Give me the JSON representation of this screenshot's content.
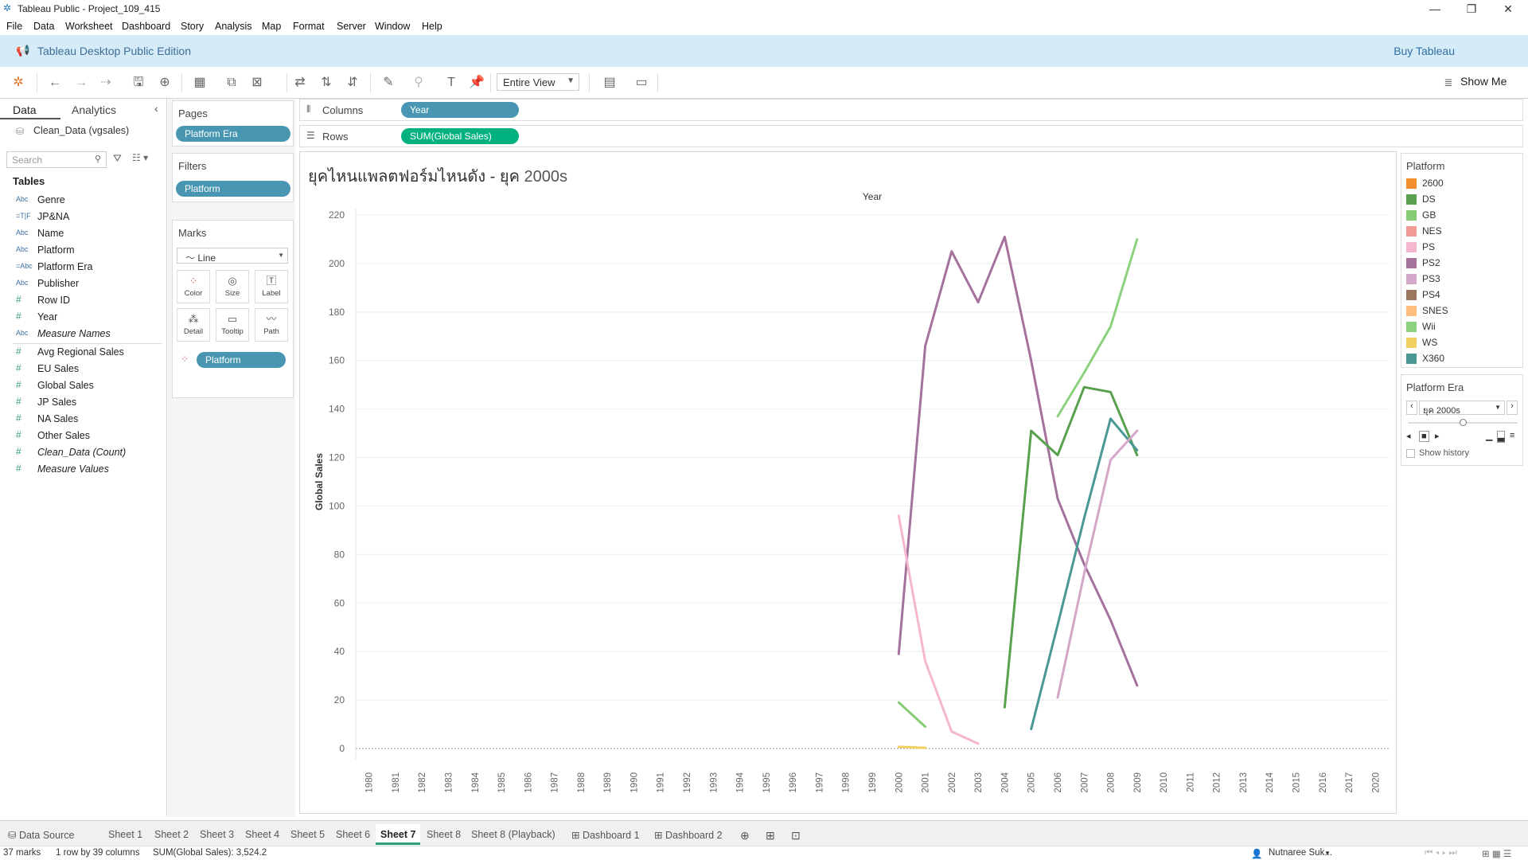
{
  "window": {
    "title": "Tableau Public - Project_109_415"
  },
  "menu": [
    "File",
    "Data",
    "Worksheet",
    "Dashboard",
    "Story",
    "Analysis",
    "Map",
    "Format",
    "Server",
    "Window",
    "Help"
  ],
  "banner": {
    "edition": "Tableau Desktop Public Edition",
    "buy": "Buy Tableau"
  },
  "toolbar": {
    "fit": "Entire View",
    "show_me": "Show Me"
  },
  "data_pane": {
    "tabs": [
      "Data",
      "Analytics"
    ],
    "datasource": "Clean_Data (vgsales)",
    "search_placeholder": "Search",
    "tables_label": "Tables",
    "dimensions": [
      {
        "icon": "Abc",
        "name": "Genre"
      },
      {
        "icon": "=T|F",
        "name": "JP&NA"
      },
      {
        "icon": "Abc",
        "name": "Name"
      },
      {
        "icon": "Abc",
        "name": "Platform"
      },
      {
        "icon": "=Abc",
        "name": "Platform Era"
      },
      {
        "icon": "Abc",
        "name": "Publisher"
      },
      {
        "icon": "#",
        "name": "Row ID"
      },
      {
        "icon": "#",
        "name": "Year"
      },
      {
        "icon": "Abc",
        "name": "Measure Names"
      }
    ],
    "measures": [
      {
        "icon": "#",
        "name": "Avg Regional Sales"
      },
      {
        "icon": "#",
        "name": "EU Sales"
      },
      {
        "icon": "#",
        "name": "Global Sales"
      },
      {
        "icon": "#",
        "name": "JP Sales"
      },
      {
        "icon": "#",
        "name": "NA Sales"
      },
      {
        "icon": "#",
        "name": "Other Sales"
      },
      {
        "icon": "#",
        "name": "Clean_Data (Count)"
      },
      {
        "icon": "#",
        "name": "Measure Values"
      }
    ]
  },
  "cards": {
    "pages": {
      "title": "Pages",
      "pill": "Platform Era"
    },
    "filters": {
      "title": "Filters",
      "pill": "Platform"
    },
    "marks": {
      "title": "Marks",
      "type": "Line",
      "buttons": [
        "Color",
        "Size",
        "Label",
        "Detail",
        "Tooltip",
        "Path"
      ],
      "color_pill": "Platform"
    }
  },
  "shelves": {
    "columns": {
      "label": "Columns",
      "pill": "Year"
    },
    "rows": {
      "label": "Rows",
      "pill": "SUM(Global Sales)"
    }
  },
  "sheet": {
    "title": "ยุคไหนแพลตฟอร์มไหนดัง - ยุค",
    "title_sub": "2000s"
  },
  "chart_data": {
    "type": "line",
    "xlabel": "Year",
    "ylabel": "Global Sales",
    "ylim": [
      0,
      220
    ],
    "yticks": [
      0,
      20,
      40,
      60,
      80,
      100,
      120,
      140,
      160,
      180,
      200,
      220
    ],
    "x": [
      1980,
      1981,
      1982,
      1983,
      1984,
      1985,
      1986,
      1987,
      1988,
      1989,
      1990,
      1991,
      1992,
      1993,
      1994,
      1995,
      1996,
      1997,
      1998,
      1999,
      2000,
      2001,
      2002,
      2003,
      2004,
      2005,
      2006,
      2007,
      2008,
      2009,
      2010,
      2011,
      2012,
      2013,
      2014,
      2015,
      2016,
      2017,
      2020
    ],
    "series": [
      {
        "name": "PS2",
        "color": "#a4729c",
        "points": [
          [
            2000,
            39
          ],
          [
            2001,
            166
          ],
          [
            2002,
            205
          ],
          [
            2003,
            184
          ],
          [
            2004,
            211
          ],
          [
            2005,
            160
          ],
          [
            2006,
            103
          ],
          [
            2007,
            76
          ],
          [
            2008,
            53
          ],
          [
            2009,
            26
          ]
        ]
      },
      {
        "name": "PS",
        "color": "#f4b7cf",
        "points": [
          [
            2000,
            96
          ],
          [
            2001,
            36
          ],
          [
            2002,
            7
          ],
          [
            2003,
            2
          ]
        ]
      },
      {
        "name": "GB",
        "color": "#86cc74",
        "points": [
          [
            2000,
            19
          ],
          [
            2001,
            9
          ]
        ]
      },
      {
        "name": "WS",
        "color": "#f2cf61",
        "points": [
          [
            2000,
            0.7
          ],
          [
            2001,
            0.3
          ]
        ]
      },
      {
        "name": "DS",
        "color": "#59a14f",
        "points": [
          [
            2004,
            17
          ],
          [
            2005,
            131
          ],
          [
            2006,
            121
          ],
          [
            2007,
            149
          ],
          [
            2008,
            147
          ],
          [
            2009,
            121
          ]
        ]
      },
      {
        "name": "Wii",
        "color": "#8cd17d",
        "points": [
          [
            2006,
            137
          ],
          [
            2007,
            155
          ],
          [
            2008,
            174
          ],
          [
            2009,
            210
          ]
        ]
      },
      {
        "name": "X360",
        "color": "#499894",
        "points": [
          [
            2005,
            8
          ],
          [
            2006,
            51
          ],
          [
            2007,
            95
          ],
          [
            2008,
            136
          ],
          [
            2009,
            123
          ]
        ]
      },
      {
        "name": "PS3",
        "color": "#d4a6c8",
        "points": [
          [
            2006,
            21
          ],
          [
            2007,
            72
          ],
          [
            2008,
            119
          ],
          [
            2009,
            131
          ]
        ]
      }
    ]
  },
  "legend": {
    "title": "Platform",
    "items": [
      {
        "label": "2600",
        "color": "#f28e2b"
      },
      {
        "label": "DS",
        "color": "#59a14f"
      },
      {
        "label": "GB",
        "color": "#86cc74"
      },
      {
        "label": "NES",
        "color": "#f49a96"
      },
      {
        "label": "PS",
        "color": "#f4b7cf"
      },
      {
        "label": "PS2",
        "color": "#a4729c"
      },
      {
        "label": "PS3",
        "color": "#d4a6c8"
      },
      {
        "label": "PS4",
        "color": "#9d7660"
      },
      {
        "label": "SNES",
        "color": "#ffbe7d"
      },
      {
        "label": "Wii",
        "color": "#8cd17d"
      },
      {
        "label": "WS",
        "color": "#f2cf61"
      },
      {
        "label": "X360",
        "color": "#499894"
      }
    ]
  },
  "page_control": {
    "title": "Platform Era",
    "value": "ยุค 2000s",
    "show_history": "Show history"
  },
  "tabs": [
    "Data Source",
    "Sheet 1",
    "Sheet 2",
    "Sheet 3",
    "Sheet 4",
    "Sheet 5",
    "Sheet 6",
    "Sheet 7",
    "Sheet 8",
    "Sheet 8 (Playback)",
    "Dashboard 1",
    "Dashboard 2"
  ],
  "active_tab": "Sheet 7",
  "status": {
    "marks": "37 marks",
    "rows": "1 row by 39 columns",
    "sum": "SUM(Global Sales): 3,524.2",
    "user": "Nutnaree Suk..."
  }
}
